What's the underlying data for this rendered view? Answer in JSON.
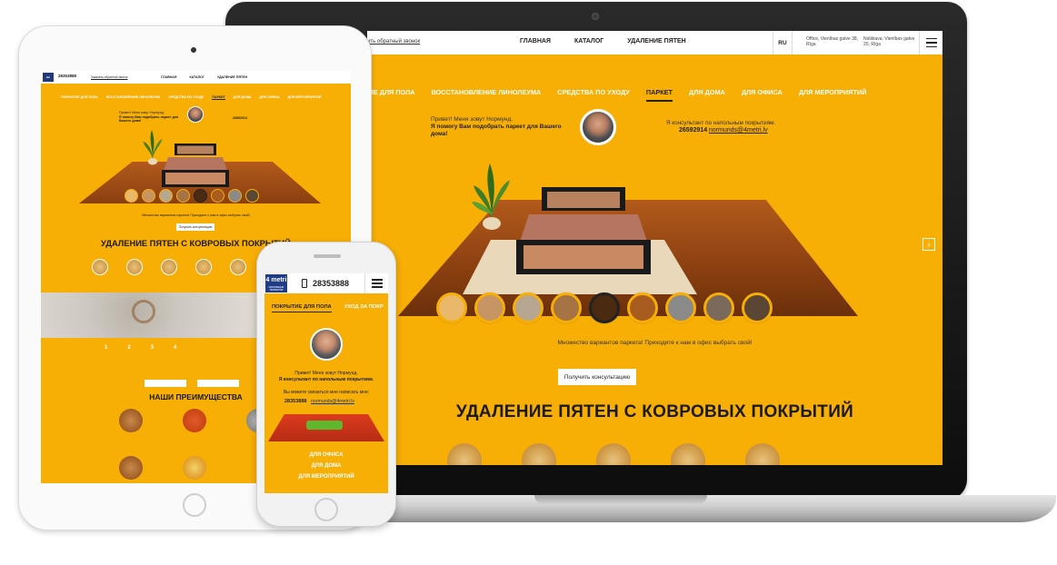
{
  "laptop": {
    "header": {
      "callback_link": "ить обратный звонок",
      "nav": [
        "ГЛАВНАЯ",
        "КАТАЛОГ",
        "УДАЛЕНИЕ ПЯТЕН"
      ],
      "lang": "RU",
      "office": "Office, Vienības gatve 38, Rīga",
      "warehouse": "Noliktava: Vienības gatve 20, Rīga"
    },
    "tabs": [
      {
        "label": "ЫТИЕ ДЛЯ ПОЛА",
        "active": false
      },
      {
        "label": "ВОССТАНОВЛЕНИЕ ЛИНОЛЕУМА",
        "active": false
      },
      {
        "label": "СРЕДСТВА ПО УХОДУ",
        "active": false
      },
      {
        "label": "ПАРКЕТ",
        "active": true
      },
      {
        "label": "ДЛЯ ДОМА",
        "active": false
      },
      {
        "label": "ДЛЯ ОФИСА",
        "active": false
      },
      {
        "label": "ДЛЯ МЕРОПРИЯТИЙ",
        "active": false
      }
    ],
    "consultant": {
      "greeting": "Привет! Меня зовут Нормунд.",
      "headline": "Я помогу Вам подобрать паркет для Вашего дома!",
      "role": "Я консультант по напольным покрытиям.",
      "phone": "26592914",
      "email": "normunds@4metri.lv"
    },
    "swatch_colors": [
      "#e9b86b",
      "#c79463",
      "#b7a791",
      "#a67344",
      "#4b2a12",
      "#a85c1f",
      "#8a8a8a",
      "#7b6a5b",
      "#5b4636"
    ],
    "selected_swatch": 4,
    "caption": "Множество вариантов паркета! Приходите к нам в офис выбрать свой!",
    "cta": "Получить консультацию",
    "section_title": "УДАЛЕНИЕ ПЯТЕН С КОВРОВЫХ ПОКРЫТИЙ",
    "arrow": "›"
  },
  "tablet": {
    "phone": "28353888",
    "callback": "Заказать обратный звонок",
    "nav": [
      "ГЛАВНАЯ",
      "КАТАЛОГ",
      "УДАЛЕНИЕ ПЯТЕН"
    ],
    "tabs": [
      {
        "label": "ПОКРЫТИЕ ДЛЯ ПОЛА",
        "active": false
      },
      {
        "label": "ВОССТАНОВЛЕНИЕ ЛИНОЛЕУМА",
        "active": false
      },
      {
        "label": "СРЕДСТВА ПО УХОДУ",
        "active": false
      },
      {
        "label": "ПАРКЕТ",
        "active": true
      },
      {
        "label": "ДЛЯ ДОМА",
        "active": false
      },
      {
        "label": "ДЛЯ ОФИСА",
        "active": false
      },
      {
        "label": "ДЛЯ МЕРОПРИЯТИЙ",
        "active": false
      }
    ],
    "greeting": "Привет! Меня зовут Нормунд.",
    "headline": "Я помогу Вам подобрать паркет для Вашего дома!",
    "contact_phone": "26592914",
    "caption": "Множество вариантов паркета! Приходите к нам в офис выбрать свой!",
    "cta": "Получить консультацию",
    "section_title": "УДАЛЕНИЕ ПЯТЕН С КОВРОВЫХ ПОКРЫТИЙ",
    "steps": [
      "1",
      "2",
      "3",
      "4"
    ],
    "advantages_title": "НАШИ ПРЕИМУЩЕСТВА",
    "swatch_colors": [
      "#e9b86b",
      "#c79463",
      "#b7a791",
      "#a67344",
      "#4b2a12",
      "#a85c1f",
      "#8a8a8a",
      "#5b4636"
    ]
  },
  "phone": {
    "logo": "4 metri",
    "logo_sub": "НАПОЛЬНЫЕ ПОКРЫТИЯ",
    "number": "28353888",
    "tabs": [
      {
        "label": "ПОКРЫТИЕ ДЛЯ ПОЛА",
        "active": true
      },
      {
        "label": "УХОД ЗА ПОКР",
        "active": false
      }
    ],
    "greeting": "Привет! Меня зовут Нормунд.",
    "role": "Я консультант по напольным покрытиям.",
    "ask": "Вы можете связаться мне написать мне:",
    "contact_phone": "28353888",
    "contact_email": "normunds@4metri.lv",
    "menu": [
      "ДЛЯ ОФИСА",
      "ДЛЯ ДОМА",
      "ДЛЯ МЕРОПРИЯТИЙ"
    ]
  },
  "colors": {
    "brand_yellow": "#f7ae05",
    "brand_blue": "#1f3c85",
    "text_dark": "#222222"
  }
}
